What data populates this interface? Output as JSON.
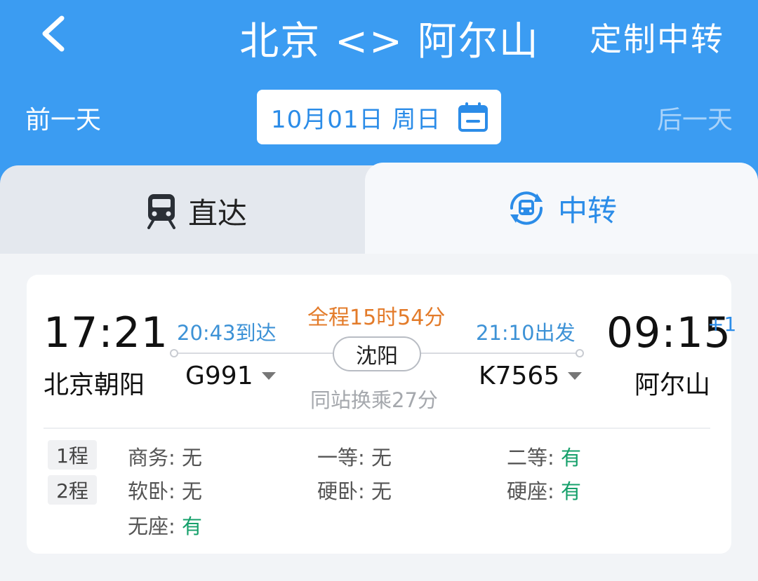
{
  "header": {
    "title": "北京 <> 阿尔山",
    "custom_transfer": "定制中转",
    "prev_day": "前一天",
    "next_day": "后一天",
    "date": "10月01日 周日"
  },
  "tabs": {
    "direct": "直达",
    "transfer": "中转"
  },
  "trip": {
    "depart_time": "17:21",
    "depart_station": "北京朝阳",
    "arrive_time": "09:15",
    "arrive_plus": "+1",
    "arrive_station": "阿尔山",
    "total_duration": "全程15时54分",
    "transfer_station": "沈阳",
    "transfer_note": "同站换乘27分",
    "leg1": {
      "arrive": "20:43到达",
      "train": "G991"
    },
    "leg2": {
      "depart": "21:10出发",
      "train": "K7565"
    }
  },
  "seats": {
    "badge1": "1程",
    "badge2": "2程",
    "items": [
      {
        "label": "商务: ",
        "value": "无"
      },
      {
        "label": "一等: ",
        "value": "无"
      },
      {
        "label": "二等: ",
        "value": "有"
      },
      {
        "label": "软卧: ",
        "value": "无"
      },
      {
        "label": "硬卧: ",
        "value": "无"
      },
      {
        "label": "硬座: ",
        "value": "有"
      },
      {
        "label": "无座: ",
        "value": "有"
      }
    ]
  },
  "colors": {
    "header_blue": "#3b9cf2",
    "accent_blue": "#2b8ce8",
    "orange": "#e37b2a",
    "green": "#16a06b"
  },
  "icons": {
    "back": "chevron-left-icon",
    "calendar": "calendar-icon",
    "direct_tab": "train-icon",
    "transfer_tab": "transfer-train-icon",
    "dropdown": "caret-down-icon"
  }
}
